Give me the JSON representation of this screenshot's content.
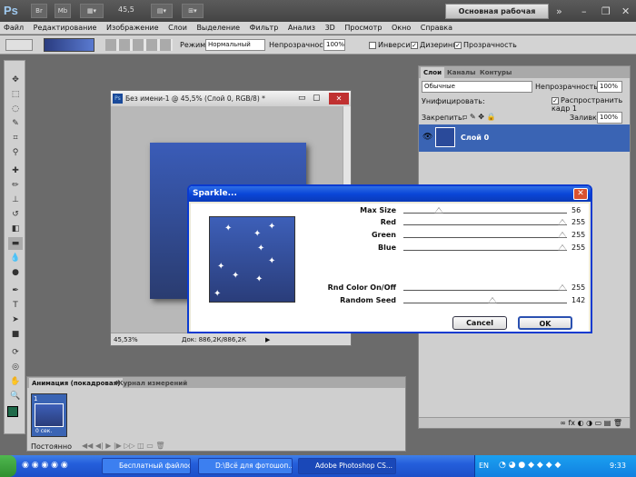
{
  "appbar": {
    "logo": "Ps",
    "zoom": "45,5",
    "workspace": "Основная рабочая среда"
  },
  "menu": [
    "Файл",
    "Редактирование",
    "Изображение",
    "Слои",
    "Выделение",
    "Фильтр",
    "Анализ",
    "3D",
    "Просмотр",
    "Окно",
    "Справка"
  ],
  "options": {
    "mode_label": "Режим:",
    "mode_value": "Нормальный",
    "opacity_label": "Непрозрачность:",
    "opacity_value": "100%",
    "inverse": "Инверсия",
    "dither": "Дизеринг",
    "transparency": "Прозрачность"
  },
  "document": {
    "title": "Без имени-1 @ 45,5% (Слой 0, RGB/8) *",
    "zoom": "45,53%",
    "doc_info": "Док: 886,2К/886,2К"
  },
  "layers": {
    "tabs": [
      "Слои",
      "Каналы",
      "Контуры"
    ],
    "blend": "Обычные",
    "opacity_label": "Непрозрачность:",
    "opacity_value": "100%",
    "unify": "Унифицировать:",
    "propagate": "Распространить кадр 1",
    "lock": "Закрепить:",
    "fill_label": "Заливка:",
    "fill_value": "100%",
    "layer_name": "Слой 0"
  },
  "animation": {
    "tabs": [
      "Анимация (покадровая)",
      "Журнал измерений"
    ],
    "frame_num": "1",
    "frame_time": "0 сек.",
    "loop": "Постоянно"
  },
  "dialog": {
    "title": "Sparkle...",
    "params": [
      {
        "label": "Max Size",
        "value": "56",
        "level": 0.22
      },
      {
        "label": "Red",
        "value": "255",
        "level": 1
      },
      {
        "label": "Green",
        "value": "255",
        "level": 1
      },
      {
        "label": "Blue",
        "value": "255",
        "level": 1
      },
      {
        "label": "Rnd Color On/Off",
        "value": "255",
        "level": 1
      },
      {
        "label": "Random Seed",
        "value": "142",
        "level": 0.56
      }
    ],
    "cancel": "Cancel",
    "ok": "OK"
  },
  "taskbar": {
    "items": [
      "Бесплатный файлоо...",
      "D:\\Всё для фотошоп...",
      "Adobe Photoshop CS..."
    ],
    "lang": "EN",
    "time": "9:33"
  }
}
